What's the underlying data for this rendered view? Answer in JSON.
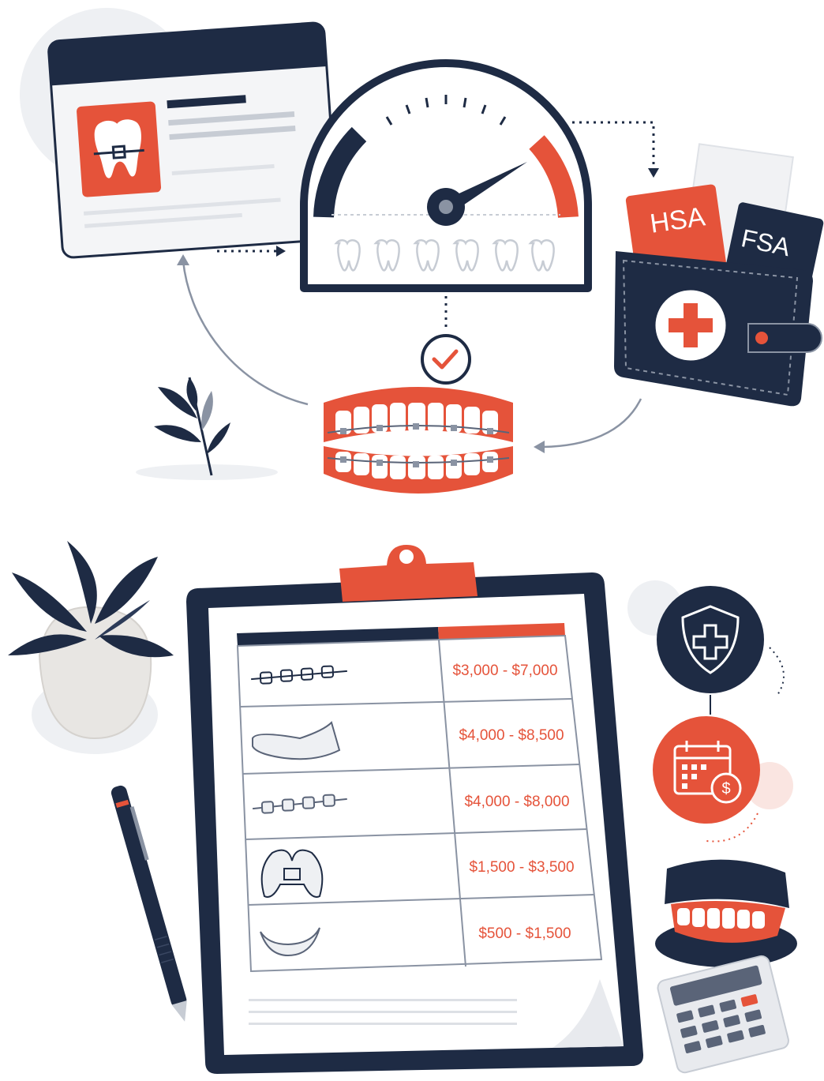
{
  "colors": {
    "navy": "#1e2b44",
    "orange": "#e5533a",
    "light_gray": "#eef0f3",
    "mid_gray": "#c7ccd4",
    "paper": "#ffffff"
  },
  "top": {
    "wallet_cards": {
      "hsa": "HSA",
      "fsa": "FSA"
    },
    "icons": [
      "tooth-braces-icon",
      "gauge-icon",
      "check-icon",
      "wallet-icon",
      "medical-cross-icon",
      "braces-teeth-icon",
      "plant-icon"
    ]
  },
  "bottom": {
    "price_table": {
      "rows": [
        {
          "icon": "metal-braces-icon",
          "price": "$3,000 - $7,000"
        },
        {
          "icon": "clear-aligner-icon",
          "price": "$4,000 - $8,500"
        },
        {
          "icon": "ceramic-braces-icon",
          "price": "$4,000 - $8,000"
        },
        {
          "icon": "palate-expander-icon",
          "price": "$1,500 - $3,500"
        },
        {
          "icon": "retainer-icon",
          "price": "$500 - $1,500"
        }
      ]
    },
    "icons": [
      "shield-plus-icon",
      "calendar-dollar-icon",
      "dentures-model-icon",
      "calculator-icon",
      "pen-icon",
      "potted-plant-icon"
    ]
  }
}
